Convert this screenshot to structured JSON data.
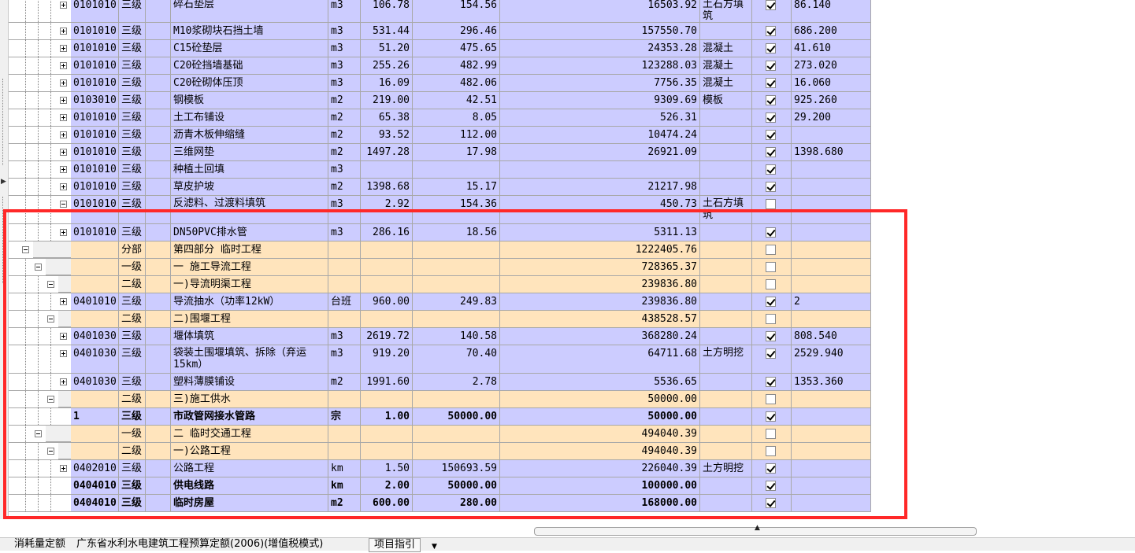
{
  "rows": [
    {
      "style": "l3",
      "depth": 3,
      "toggle": "plus",
      "code": "0101010",
      "level": "三级",
      "name": "碎石垫层",
      "unit": "m3",
      "qty": "106.78",
      "price": "154.56",
      "total": "16503.92",
      "type": "土石方填筑",
      "checked": true,
      "extra": "86.140"
    },
    {
      "style": "l3",
      "depth": 3,
      "toggle": "plus",
      "code": "0101010",
      "level": "三级",
      "name": "M10浆砌块石挡土墙",
      "unit": "m3",
      "qty": "531.44",
      "price": "296.46",
      "total": "157550.70",
      "type": "",
      "checked": true,
      "extra": "686.200"
    },
    {
      "style": "l3",
      "depth": 3,
      "toggle": "plus",
      "code": "0101010",
      "level": "三级",
      "name": "C15砼垫层",
      "unit": "m3",
      "qty": "51.20",
      "price": "475.65",
      "total": "24353.28",
      "type": "混凝土",
      "checked": true,
      "extra": "41.610"
    },
    {
      "style": "l3",
      "depth": 3,
      "toggle": "plus",
      "code": "0101010",
      "level": "三级",
      "name": "C20砼挡墙基础",
      "unit": "m3",
      "qty": "255.26",
      "price": "482.99",
      "total": "123288.03",
      "type": "混凝土",
      "checked": true,
      "extra": "273.020"
    },
    {
      "style": "l3",
      "depth": 3,
      "toggle": "plus",
      "code": "0101010",
      "level": "三级",
      "name": "C20砼砌体压顶",
      "unit": "m3",
      "qty": "16.09",
      "price": "482.06",
      "total": "7756.35",
      "type": "混凝土",
      "checked": true,
      "extra": "16.060"
    },
    {
      "style": "l3",
      "depth": 3,
      "toggle": "plus",
      "code": "0103010",
      "level": "三级",
      "name": "钢模板",
      "unit": "m2",
      "qty": "219.00",
      "price": "42.51",
      "total": "9309.69",
      "type": "模板",
      "checked": true,
      "extra": "925.260"
    },
    {
      "style": "l3",
      "depth": 3,
      "toggle": "plus",
      "code": "0101010",
      "level": "三级",
      "name": "土工布铺设",
      "unit": "m2",
      "qty": "65.38",
      "price": "8.05",
      "total": "526.31",
      "type": "",
      "checked": true,
      "extra": "29.200"
    },
    {
      "style": "l3",
      "depth": 3,
      "toggle": "plus",
      "code": "0101010",
      "level": "三级",
      "name": "沥青木板伸缩缝",
      "unit": "m2",
      "qty": "93.52",
      "price": "112.00",
      "total": "10474.24",
      "type": "",
      "checked": true,
      "extra": ""
    },
    {
      "style": "l3",
      "depth": 3,
      "toggle": "plus",
      "code": "0101010",
      "level": "三级",
      "name": "三维网垫",
      "unit": "m2",
      "qty": "1497.28",
      "price": "17.98",
      "total": "26921.09",
      "type": "",
      "checked": true,
      "extra": "1398.680"
    },
    {
      "style": "l3",
      "depth": 3,
      "toggle": "plus",
      "code": "0101010",
      "level": "三级",
      "name": "种植土回填",
      "unit": "m3",
      "qty": "",
      "price": "",
      "total": "",
      "type": "",
      "checked": true,
      "extra": ""
    },
    {
      "style": "l3",
      "depth": 3,
      "toggle": "plus",
      "code": "0101010",
      "level": "三级",
      "name": "草皮护坡",
      "unit": "m2",
      "qty": "1398.68",
      "price": "15.17",
      "total": "21217.98",
      "type": "",
      "checked": true,
      "extra": ""
    },
    {
      "style": "l3",
      "depth": 3,
      "toggle": "minus",
      "code": "0101010",
      "level": "三级",
      "name": "反滤料、过渡料填筑",
      "unit": "m3",
      "qty": "2.92",
      "price": "154.36",
      "total": "450.73",
      "type": "土石方填筑",
      "checked": false,
      "extra": ""
    },
    {
      "style": "l3",
      "depth": 3,
      "toggle": "plus",
      "code": "0101010",
      "level": "三级",
      "name": "DN50PVC排水管",
      "unit": "m3",
      "qty": "286.16",
      "price": "18.56",
      "total": "5311.13",
      "type": "",
      "checked": true,
      "extra": ""
    },
    {
      "style": "fb",
      "depth": 0,
      "toggle": "minus",
      "code": "",
      "level": "分部",
      "name": "第四部分 临时工程",
      "unit": "",
      "qty": "",
      "price": "",
      "total": "1222405.76",
      "type": "",
      "checked": false,
      "extra": ""
    },
    {
      "style": "fb",
      "depth": 1,
      "toggle": "minus",
      "code": "",
      "level": "一级",
      "name": "一 施工导流工程",
      "unit": "",
      "qty": "",
      "price": "",
      "total": "728365.37",
      "type": "",
      "checked": false,
      "extra": ""
    },
    {
      "style": "fb",
      "depth": 2,
      "toggle": "minus",
      "code": "",
      "level": "二级",
      "name": "一)导流明渠工程",
      "unit": "",
      "qty": "",
      "price": "",
      "total": "239836.80",
      "type": "",
      "checked": false,
      "extra": ""
    },
    {
      "style": "l3",
      "depth": 3,
      "toggle": "plus",
      "code": "0401010",
      "level": "三级",
      "name": "导流抽水（功率12kW）",
      "unit": "台班",
      "qty": "960.00",
      "price": "249.83",
      "total": "239836.80",
      "type": "",
      "checked": true,
      "extra": "2"
    },
    {
      "style": "fb",
      "depth": 2,
      "toggle": "minus",
      "code": "",
      "level": "二级",
      "name": "二)围堰工程",
      "unit": "",
      "qty": "",
      "price": "",
      "total": "438528.57",
      "type": "",
      "checked": false,
      "extra": ""
    },
    {
      "style": "l3",
      "depth": 3,
      "toggle": "plus",
      "code": "0401030",
      "level": "三级",
      "name": "堰体填筑",
      "unit": "m3",
      "qty": "2619.72",
      "price": "140.58",
      "total": "368280.24",
      "type": "",
      "checked": true,
      "extra": "808.540"
    },
    {
      "style": "l3",
      "depth": 3,
      "toggle": "plus",
      "code": "0401030",
      "level": "三级",
      "name": "袋装土围堰填筑、拆除（弃运15km）",
      "unit": "m3",
      "qty": "919.20",
      "price": "70.40",
      "total": "64711.68",
      "type": "土方明挖",
      "checked": true,
      "extra": "2529.940"
    },
    {
      "style": "l3",
      "depth": 3,
      "toggle": "plus",
      "code": "0401030",
      "level": "三级",
      "name": "塑料薄膜铺设",
      "unit": "m2",
      "qty": "1991.60",
      "price": "2.78",
      "total": "5536.65",
      "type": "",
      "checked": true,
      "extra": "1353.360"
    },
    {
      "style": "fb",
      "depth": 2,
      "toggle": "minus",
      "code": "",
      "level": "二级",
      "name": "三)施工供水",
      "unit": "",
      "qty": "",
      "price": "",
      "total": "50000.00",
      "type": "",
      "checked": false,
      "extra": ""
    },
    {
      "style": "l3 bold",
      "depth": 3,
      "toggle": "none",
      "code": "1",
      "level": "三级",
      "name": "市政管网接水管路",
      "unit": "宗",
      "qty": "1.00",
      "price": "50000.00",
      "total": "50000.00",
      "type": "",
      "checked": true,
      "extra": ""
    },
    {
      "style": "fb",
      "depth": 1,
      "toggle": "minus",
      "code": "",
      "level": "一级",
      "name": "二 临时交通工程",
      "unit": "",
      "qty": "",
      "price": "",
      "total": "494040.39",
      "type": "",
      "checked": false,
      "extra": ""
    },
    {
      "style": "fb",
      "depth": 2,
      "toggle": "minus",
      "code": "",
      "level": "二级",
      "name": "一)公路工程",
      "unit": "",
      "qty": "",
      "price": "",
      "total": "494040.39",
      "type": "",
      "checked": false,
      "extra": ""
    },
    {
      "style": "l3",
      "depth": 3,
      "toggle": "plus",
      "code": "0402010",
      "level": "三级",
      "name": "公路工程",
      "unit": "km",
      "qty": "1.50",
      "price": "150693.59",
      "total": "226040.39",
      "type": "土方明挖",
      "checked": true,
      "extra": ""
    },
    {
      "style": "l3 bold",
      "depth": 3,
      "toggle": "none",
      "code": "0404010",
      "level": "三级",
      "name": "供电线路",
      "unit": "km",
      "qty": "2.00",
      "price": "50000.00",
      "total": "100000.00",
      "type": "",
      "checked": true,
      "extra": ""
    },
    {
      "style": "l3 bold",
      "depth": 3,
      "toggle": "none",
      "code": "0404010",
      "level": "三级",
      "name": "临时房屋",
      "unit": "m2",
      "qty": "600.00",
      "price": "280.00",
      "total": "168000.00",
      "type": "",
      "checked": true,
      "extra": ""
    }
  ],
  "status": {
    "label": "消耗量定额",
    "quota_value": "广东省水利水电建筑工程预算定额(2006)(增值税模式)",
    "guide_button": "项目指引"
  }
}
